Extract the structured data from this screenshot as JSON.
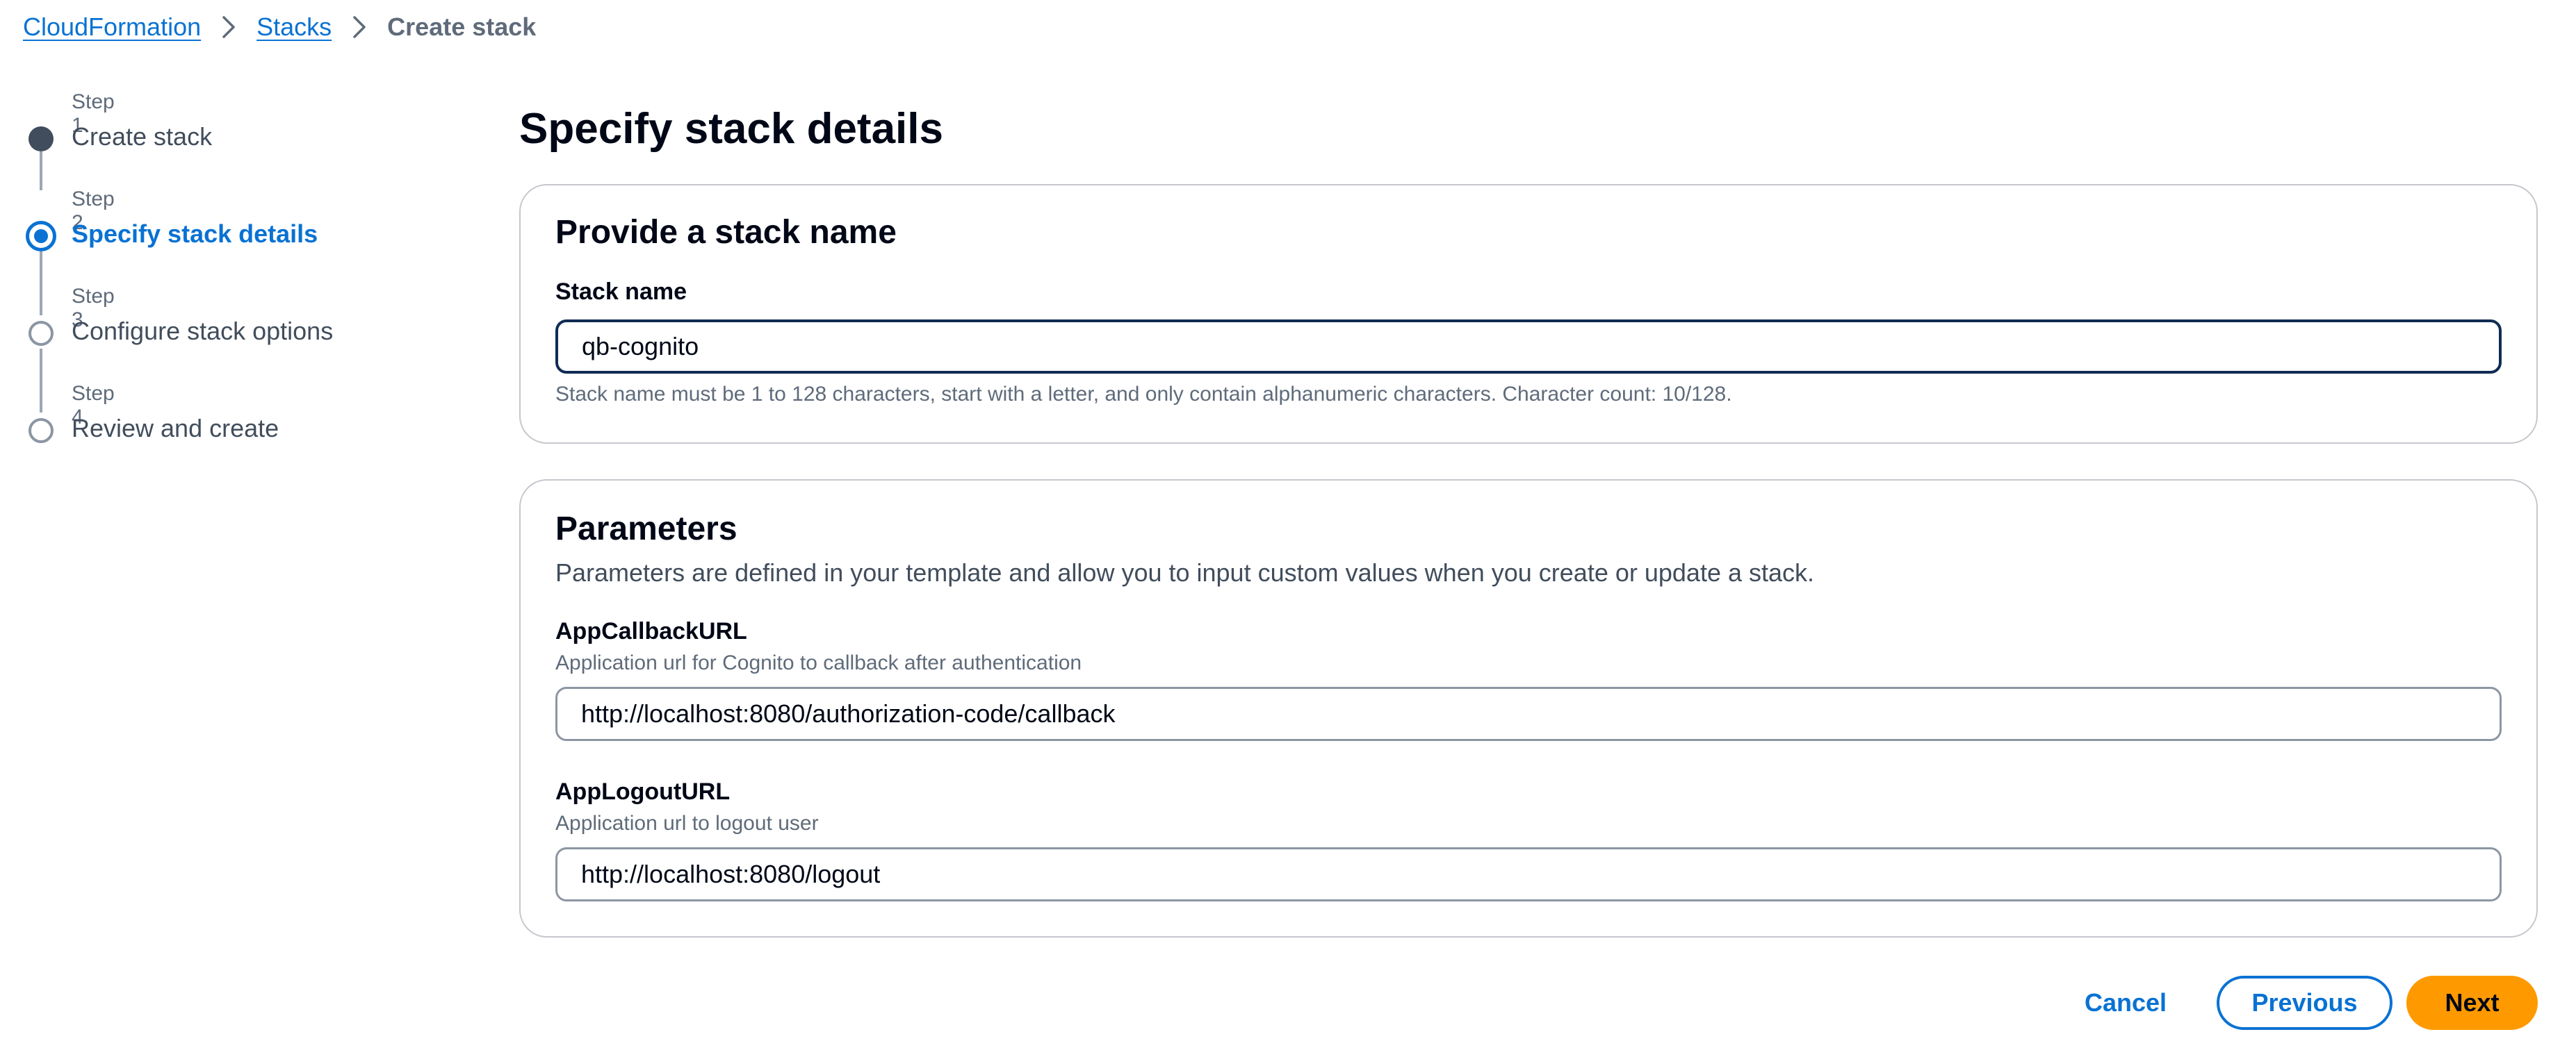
{
  "breadcrumb": {
    "items": [
      {
        "label": "CloudFormation"
      },
      {
        "label": "Stacks"
      },
      {
        "label": "Create stack"
      }
    ]
  },
  "steps": [
    {
      "number": "Step 1",
      "title": "Create stack",
      "state": "completed"
    },
    {
      "number": "Step 2",
      "title": "Specify stack details",
      "state": "current"
    },
    {
      "number": "Step 3",
      "title": "Configure stack options",
      "state": "pending"
    },
    {
      "number": "Step 4",
      "title": "Review and create",
      "state": "pending"
    }
  ],
  "page": {
    "title": "Specify stack details"
  },
  "stack_name_section": {
    "title": "Provide a stack name",
    "field_label": "Stack name",
    "value": "qb-cognito",
    "hint": "Stack name must be 1 to 128 characters, start with a letter, and only contain alphanumeric characters. Character count: 10/128."
  },
  "parameters": {
    "title": "Parameters",
    "description": "Parameters are defined in your template and allow you to input custom values when you create or update a stack.",
    "fields": [
      {
        "label": "AppCallbackURL",
        "description": "Application url for Cognito to callback after authentication",
        "value": "http://localhost:8080/authorization-code/callback"
      },
      {
        "label": "AppLogoutURL",
        "description": "Application url to logout user",
        "value": "http://localhost:8080/logout"
      }
    ]
  },
  "actions": {
    "cancel": "Cancel",
    "previous": "Previous",
    "next": "Next"
  },
  "colors": {
    "link": "#0972d3",
    "primary_button": "#ff9900",
    "text": "#000716",
    "muted": "#5f6b7a",
    "border": "#c6c6cd"
  },
  "icons": {
    "separator": "chevron-right-icon"
  }
}
